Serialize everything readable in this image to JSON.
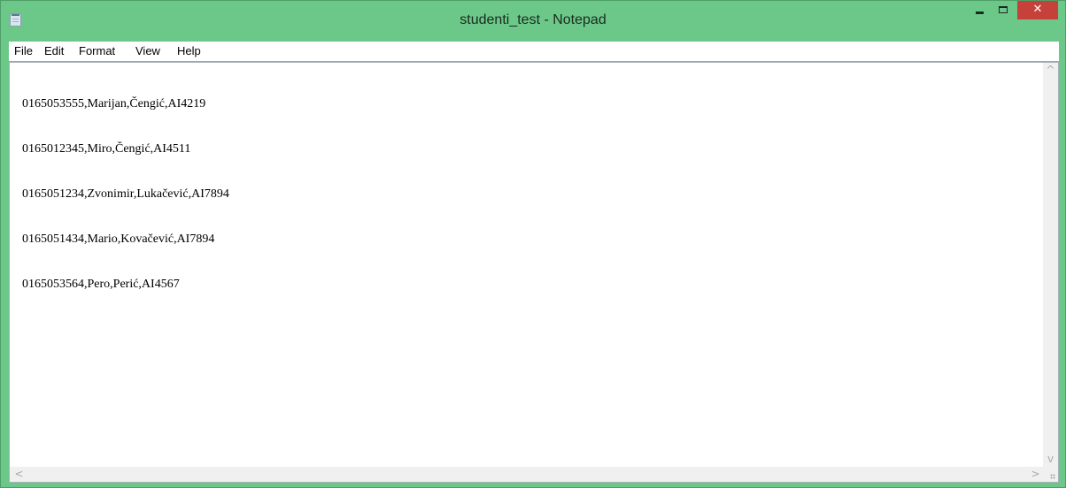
{
  "window": {
    "title": "studenti_test - Notepad",
    "icon": "notepad-icon",
    "accent_color": "#6cc888",
    "close_color": "#c7413b",
    "controls": {
      "minimize_icon": "minimize-icon",
      "maximize_icon": "maximize-icon",
      "close_label": "✕"
    }
  },
  "menu": {
    "items": [
      "File",
      "Edit",
      "Format",
      "View",
      "Help"
    ]
  },
  "document": {
    "lines": [
      "0165053555,Marijan,Čengić,AI4219",
      "0165012345,Miro,Čengić,AI4511",
      "0165051234,Zvonimir,Lukačević,AI7894",
      "0165051434,Mario,Kovačević,AI7894",
      "0165053564,Pero,Perić,AI4567"
    ]
  },
  "scrollbars": {
    "up_arrow": "^",
    "down_arrow": "v",
    "left_arrow": "<",
    "right_arrow": ">"
  }
}
